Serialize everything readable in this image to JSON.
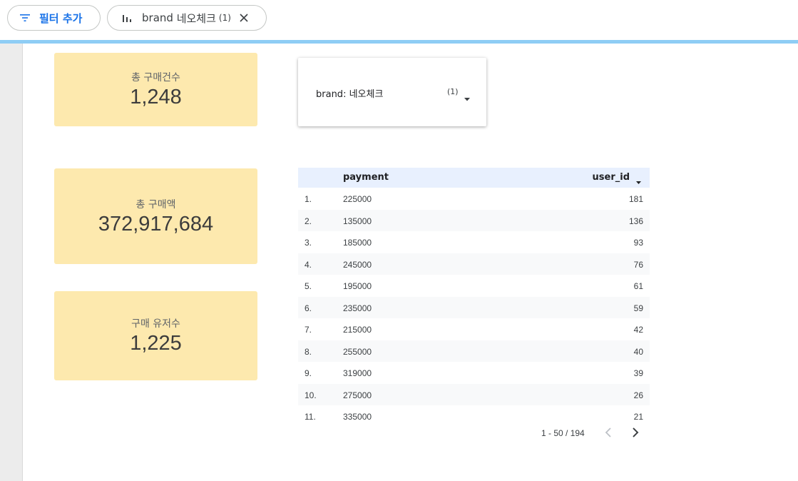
{
  "filter_bar": {
    "add_filter_label": "필터 추가",
    "brand_chip": {
      "field": "brand",
      "value": "네오체크",
      "count": "(1)"
    }
  },
  "scorecards": [
    {
      "label": "총 구매건수",
      "value": "1,248"
    },
    {
      "label": "총 구매액",
      "value": "372,917,684"
    },
    {
      "label": "구매 유저수",
      "value": "1,225"
    }
  ],
  "filter_control": {
    "field": "brand",
    "value": "네오체크",
    "count": "(1)"
  },
  "table": {
    "columns": [
      "payment",
      "user_id"
    ],
    "rows": [
      {
        "idx": "1.",
        "payment": "225000",
        "user_id": "181"
      },
      {
        "idx": "2.",
        "payment": "135000",
        "user_id": "136"
      },
      {
        "idx": "3.",
        "payment": "185000",
        "user_id": "93"
      },
      {
        "idx": "4.",
        "payment": "245000",
        "user_id": "76"
      },
      {
        "idx": "5.",
        "payment": "195000",
        "user_id": "61"
      },
      {
        "idx": "6.",
        "payment": "235000",
        "user_id": "59"
      },
      {
        "idx": "7.",
        "payment": "215000",
        "user_id": "42"
      },
      {
        "idx": "8.",
        "payment": "255000",
        "user_id": "40"
      },
      {
        "idx": "9.",
        "payment": "319000",
        "user_id": "39"
      },
      {
        "idx": "10.",
        "payment": "275000",
        "user_id": "26"
      },
      {
        "idx": "11.",
        "payment": "335000",
        "user_id": "21"
      }
    ],
    "pagination": "1 - 50 / 194"
  },
  "icons": {
    "filter": "filter-list-icon",
    "chart": "bar-chart-icon",
    "close": "close-icon",
    "caret": "caret-down-icon",
    "prev": "chevron-left-icon",
    "next": "chevron-right-icon"
  },
  "colors": {
    "accent": "#1a73e8",
    "scorecard_bg": "#fde9ae",
    "divider": "#8ecdf5",
    "header_bg": "#e8f0fe"
  }
}
